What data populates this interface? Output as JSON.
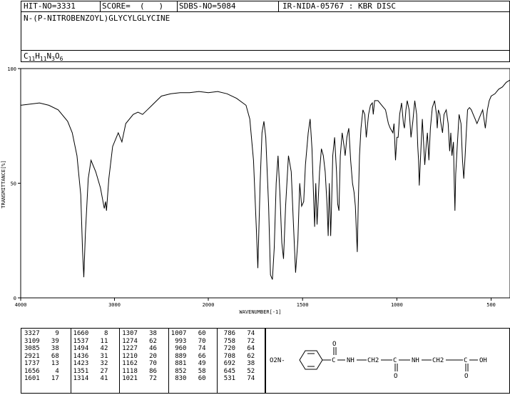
{
  "header": {
    "hit_no": "HIT-NO=3331",
    "score": "SCORE=  (   )",
    "sdbs_no": "SDBS-NO=5084",
    "ir_no": "IR-NIDA-05767 : KBR DISC",
    "compound_name": "N-(P-NITROBENZOYL)GLYCYLGLYCINE",
    "formula_parts": [
      {
        "t": "C",
        "sub": false
      },
      {
        "t": "11",
        "sub": true
      },
      {
        "t": "H",
        "sub": false
      },
      {
        "t": "11",
        "sub": true
      },
      {
        "t": "N",
        "sub": false
      },
      {
        "t": "3",
        "sub": true
      },
      {
        "t": "O",
        "sub": false
      },
      {
        "t": "6",
        "sub": true
      }
    ]
  },
  "chart_data": {
    "type": "line",
    "title": "",
    "xlabel": "WAVENUMBER[-1]",
    "ylabel": "TRANSMITTANCE[%]",
    "xlim": [
      4000,
      400
    ],
    "ylim": [
      0,
      100
    ],
    "x_ticks": [
      4000,
      3000,
      2000,
      1500,
      1000,
      500
    ],
    "y_ticks": [
      0,
      50,
      100
    ],
    "grid": false,
    "series": [
      {
        "name": "",
        "points": [
          [
            4000,
            84
          ],
          [
            3800,
            85
          ],
          [
            3700,
            84
          ],
          [
            3600,
            82
          ],
          [
            3500,
            77
          ],
          [
            3450,
            72
          ],
          [
            3400,
            62
          ],
          [
            3360,
            45
          ],
          [
            3340,
            20
          ],
          [
            3327,
            9
          ],
          [
            3310,
            28
          ],
          [
            3280,
            52
          ],
          [
            3250,
            60
          ],
          [
            3200,
            55
          ],
          [
            3150,
            48
          ],
          [
            3109,
            39
          ],
          [
            3095,
            42
          ],
          [
            3085,
            38
          ],
          [
            3060,
            52
          ],
          [
            3020,
            66
          ],
          [
            2960,
            72
          ],
          [
            2921,
            68
          ],
          [
            2880,
            76
          ],
          [
            2800,
            80
          ],
          [
            2750,
            81
          ],
          [
            2700,
            80
          ],
          [
            2650,
            82
          ],
          [
            2600,
            84
          ],
          [
            2550,
            86
          ],
          [
            2500,
            88
          ],
          [
            2400,
            89
          ],
          [
            2300,
            89.5
          ],
          [
            2200,
            89.5
          ],
          [
            2100,
            90
          ],
          [
            2000,
            89.5
          ],
          [
            1950,
            90
          ],
          [
            1900,
            89
          ],
          [
            1850,
            87
          ],
          [
            1800,
            84
          ],
          [
            1780,
            78
          ],
          [
            1760,
            60
          ],
          [
            1745,
            30
          ],
          [
            1737,
            13
          ],
          [
            1725,
            50
          ],
          [
            1715,
            72
          ],
          [
            1705,
            77
          ],
          [
            1695,
            70
          ],
          [
            1680,
            40
          ],
          [
            1670,
            10
          ],
          [
            1660,
            8
          ],
          [
            1650,
            22
          ],
          [
            1640,
            50
          ],
          [
            1630,
            62
          ],
          [
            1620,
            45
          ],
          [
            1610,
            24
          ],
          [
            1601,
            17
          ],
          [
            1590,
            40
          ],
          [
            1575,
            62
          ],
          [
            1560,
            55
          ],
          [
            1550,
            35
          ],
          [
            1537,
            11
          ],
          [
            1525,
            25
          ],
          [
            1515,
            50
          ],
          [
            1505,
            40
          ],
          [
            1494,
            42
          ],
          [
            1485,
            58
          ],
          [
            1470,
            72
          ],
          [
            1460,
            78
          ],
          [
            1450,
            65
          ],
          [
            1440,
            40
          ],
          [
            1436,
            31
          ],
          [
            1430,
            50
          ],
          [
            1423,
            32
          ],
          [
            1410,
            55
          ],
          [
            1400,
            65
          ],
          [
            1390,
            62
          ],
          [
            1380,
            55
          ],
          [
            1370,
            40
          ],
          [
            1364,
            27
          ],
          [
            1358,
            50
          ],
          [
            1351,
            27
          ],
          [
            1345,
            45
          ],
          [
            1340,
            62
          ],
          [
            1330,
            70
          ],
          [
            1320,
            55
          ],
          [
            1314,
            41
          ],
          [
            1307,
            38
          ],
          [
            1300,
            62
          ],
          [
            1290,
            72
          ],
          [
            1280,
            66
          ],
          [
            1274,
            62
          ],
          [
            1265,
            70
          ],
          [
            1255,
            74
          ],
          [
            1245,
            60
          ],
          [
            1235,
            50
          ],
          [
            1227,
            46
          ],
          [
            1220,
            40
          ],
          [
            1215,
            30
          ],
          [
            1210,
            20
          ],
          [
            1205,
            40
          ],
          [
            1198,
            62
          ],
          [
            1190,
            74
          ],
          [
            1180,
            82
          ],
          [
            1170,
            80
          ],
          [
            1162,
            70
          ],
          [
            1150,
            80
          ],
          [
            1140,
            84
          ],
          [
            1130,
            85
          ],
          [
            1125,
            80
          ],
          [
            1118,
            86
          ],
          [
            1100,
            86
          ],
          [
            1080,
            84
          ],
          [
            1060,
            82
          ],
          [
            1045,
            76
          ],
          [
            1035,
            74
          ],
          [
            1021,
            72
          ],
          [
            1015,
            76
          ],
          [
            1007,
            60
          ],
          [
            1000,
            70
          ],
          [
            993,
            70
          ],
          [
            985,
            80
          ],
          [
            975,
            85
          ],
          [
            965,
            76
          ],
          [
            960,
            74
          ],
          [
            952,
            82
          ],
          [
            945,
            86
          ],
          [
            935,
            82
          ],
          [
            925,
            70
          ],
          [
            915,
            77
          ],
          [
            905,
            86
          ],
          [
            895,
            80
          ],
          [
            889,
            66
          ],
          [
            885,
            60
          ],
          [
            881,
            49
          ],
          [
            875,
            60
          ],
          [
            865,
            78
          ],
          [
            852,
            58
          ],
          [
            845,
            66
          ],
          [
            838,
            72
          ],
          [
            830,
            60
          ],
          [
            822,
            74
          ],
          [
            812,
            83
          ],
          [
            800,
            86
          ],
          [
            790,
            80
          ],
          [
            786,
            74
          ],
          [
            780,
            82
          ],
          [
            772,
            80
          ],
          [
            768,
            77
          ],
          [
            758,
            72
          ],
          [
            750,
            80
          ],
          [
            738,
            82
          ],
          [
            728,
            76
          ],
          [
            720,
            64
          ],
          [
            714,
            72
          ],
          [
            708,
            62
          ],
          [
            700,
            68
          ],
          [
            695,
            48
          ],
          [
            692,
            38
          ],
          [
            688,
            54
          ],
          [
            680,
            66
          ],
          [
            670,
            80
          ],
          [
            660,
            76
          ],
          [
            652,
            60
          ],
          [
            645,
            52
          ],
          [
            638,
            62
          ],
          [
            632,
            72
          ],
          [
            625,
            82
          ],
          [
            615,
            83
          ],
          [
            605,
            82
          ],
          [
            595,
            80
          ],
          [
            585,
            78
          ],
          [
            575,
            76
          ],
          [
            565,
            78
          ],
          [
            555,
            80
          ],
          [
            545,
            82
          ],
          [
            531,
            74
          ],
          [
            520,
            82
          ],
          [
            510,
            86
          ],
          [
            500,
            88
          ],
          [
            480,
            89
          ],
          [
            460,
            91
          ],
          [
            440,
            92
          ],
          [
            420,
            94
          ],
          [
            400,
            95
          ]
        ]
      }
    ],
    "peak_table": [
      [
        [
          3327,
          9
        ],
        [
          3109,
          39
        ],
        [
          3085,
          38
        ],
        [
          2921,
          68
        ],
        [
          1737,
          13
        ],
        [
          1656,
          4
        ],
        [
          1601,
          17
        ]
      ],
      [
        [
          1660,
          8
        ],
        [
          1537,
          11
        ],
        [
          1494,
          42
        ],
        [
          1436,
          31
        ],
        [
          1423,
          32
        ],
        [
          1351,
          27
        ],
        [
          1314,
          41
        ]
      ],
      [
        [
          1307,
          38
        ],
        [
          1274,
          62
        ],
        [
          1227,
          46
        ],
        [
          1210,
          20
        ],
        [
          1162,
          70
        ],
        [
          1118,
          86
        ],
        [
          1021,
          72
        ]
      ],
      [
        [
          1007,
          60
        ],
        [
          993,
          70
        ],
        [
          960,
          74
        ],
        [
          889,
          66
        ],
        [
          881,
          49
        ],
        [
          852,
          58
        ],
        [
          830,
          60
        ]
      ],
      [
        [
          786,
          74
        ],
        [
          758,
          72
        ],
        [
          720,
          64
        ],
        [
          708,
          62
        ],
        [
          692,
          38
        ],
        [
          645,
          52
        ],
        [
          531,
          74
        ]
      ]
    ]
  },
  "structure": {
    "left_group": "O2N-",
    "carbonyl_o": "O",
    "label_nh1": "NH",
    "label_ch2_1": "CH2",
    "label_nh2": "NH",
    "label_ch2_2": "CH2",
    "label_oh": "OH"
  }
}
